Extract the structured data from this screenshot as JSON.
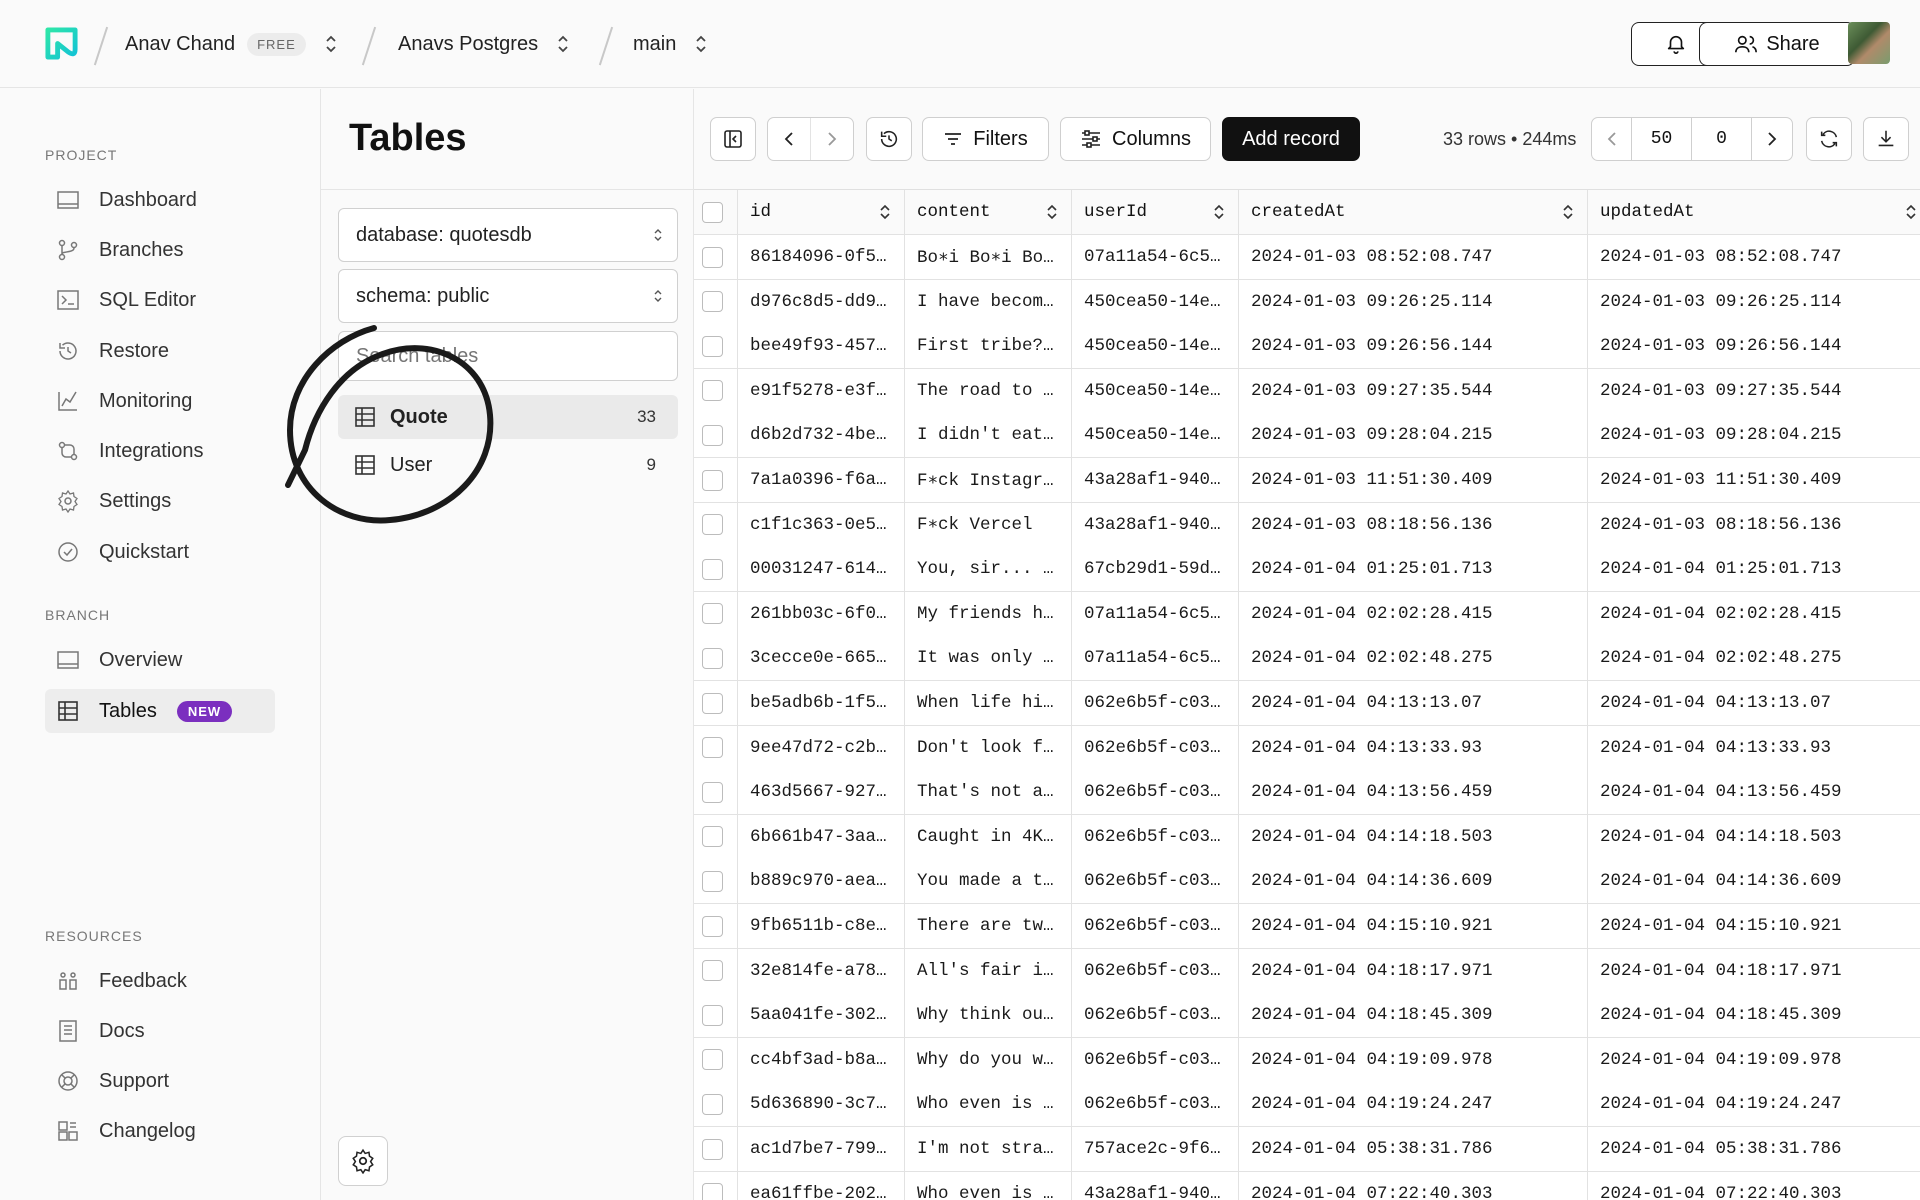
{
  "topbar": {
    "org_name": "Anav Chand",
    "plan_badge": "FREE",
    "project_name": "Anavs Postgres",
    "branch_name": "main",
    "share_label": "Share"
  },
  "sidebar": {
    "project_label": "PROJECT",
    "project_items": [
      {
        "label": "Dashboard",
        "icon": "dashboard-icon"
      },
      {
        "label": "Branches",
        "icon": "branches-icon"
      },
      {
        "label": "SQL Editor",
        "icon": "sql-editor-icon"
      },
      {
        "label": "Restore",
        "icon": "restore-icon"
      },
      {
        "label": "Monitoring",
        "icon": "monitoring-icon"
      },
      {
        "label": "Integrations",
        "icon": "integrations-icon"
      },
      {
        "label": "Settings",
        "icon": "settings-icon"
      },
      {
        "label": "Quickstart",
        "icon": "quickstart-icon"
      }
    ],
    "branch_label": "BRANCH",
    "branch_items": [
      {
        "label": "Overview",
        "icon": "overview-icon"
      },
      {
        "label": "Tables",
        "icon": "tables-icon",
        "badge": "NEW",
        "active": true
      }
    ],
    "resources_label": "RESOURCES",
    "resource_items": [
      {
        "label": "Feedback",
        "icon": "feedback-icon"
      },
      {
        "label": "Docs",
        "icon": "docs-icon"
      },
      {
        "label": "Support",
        "icon": "support-icon"
      },
      {
        "label": "Changelog",
        "icon": "changelog-icon"
      }
    ],
    "accent_color": "#7b2fbf"
  },
  "tables_panel": {
    "title": "Tables",
    "database_select": "database: quotesdb",
    "schema_select": "schema: public",
    "search_placeholder": "Search tables",
    "tables": [
      {
        "name": "Quote",
        "count": "33",
        "active": true
      },
      {
        "name": "User",
        "count": "9",
        "active": false
      }
    ]
  },
  "toolbar": {
    "filters_label": "Filters",
    "columns_label": "Columns",
    "add_record_label": "Add record",
    "rows_info": "33 rows • 244ms",
    "page_limit": "50",
    "page_offset": "0"
  },
  "grid": {
    "columns": [
      "id",
      "content",
      "userId",
      "createdAt",
      "updatedAt"
    ],
    "rows": [
      [
        "86184096-0f5…",
        "Bo∗i Bo∗i Bo…",
        "07a11a54-6c5…",
        "2024-01-03 08:52:08.747",
        "2024-01-03 08:52:08.747"
      ],
      [
        "d976c8d5-dd9…",
        "I have becom…",
        "450cea50-14e…",
        "2024-01-03 09:26:25.114",
        "2024-01-03 09:26:25.114"
      ],
      [
        "bee49f93-457…",
        "First tribe?…",
        "450cea50-14e…",
        "2024-01-03 09:26:56.144",
        "2024-01-03 09:26:56.144"
      ],
      [
        "e91f5278-e3f…",
        "The road to …",
        "450cea50-14e…",
        "2024-01-03 09:27:35.544",
        "2024-01-03 09:27:35.544"
      ],
      [
        "d6b2d732-4be…",
        "I didn't eat…",
        "450cea50-14e…",
        "2024-01-03 09:28:04.215",
        "2024-01-03 09:28:04.215"
      ],
      [
        "7a1a0396-f6a…",
        "F∗ck Instagr…",
        "43a28af1-940…",
        "2024-01-03 11:51:30.409",
        "2024-01-03 11:51:30.409"
      ],
      [
        "c1f1c363-0e5…",
        "F∗ck Vercel",
        "43a28af1-940…",
        "2024-01-03 08:18:56.136",
        "2024-01-03 08:18:56.136"
      ],
      [
        "00031247-614…",
        "You, sir... …",
        "67cb29d1-59d…",
        "2024-01-04 01:25:01.713",
        "2024-01-04 01:25:01.713"
      ],
      [
        "261bb03c-6f0…",
        "My friends h…",
        "07a11a54-6c5…",
        "2024-01-04 02:02:28.415",
        "2024-01-04 02:02:28.415"
      ],
      [
        "3cecce0e-665…",
        "It was only …",
        "07a11a54-6c5…",
        "2024-01-04 02:02:48.275",
        "2024-01-04 02:02:48.275"
      ],
      [
        "be5adb6b-1f5…",
        "When life hi…",
        "062e6b5f-c03…",
        "2024-01-04 04:13:13.07",
        "2024-01-04 04:13:13.07"
      ],
      [
        "9ee47d72-c2b…",
        "Don't look f…",
        "062e6b5f-c03…",
        "2024-01-04 04:13:33.93",
        "2024-01-04 04:13:33.93"
      ],
      [
        "463d5667-927…",
        "That's not a…",
        "062e6b5f-c03…",
        "2024-01-04 04:13:56.459",
        "2024-01-04 04:13:56.459"
      ],
      [
        "6b661b47-3aa…",
        "Caught in 4K…",
        "062e6b5f-c03…",
        "2024-01-04 04:14:18.503",
        "2024-01-04 04:14:18.503"
      ],
      [
        "b889c970-aea…",
        "You made a t…",
        "062e6b5f-c03…",
        "2024-01-04 04:14:36.609",
        "2024-01-04 04:14:36.609"
      ],
      [
        "9fb6511b-c8e…",
        "There are tw…",
        "062e6b5f-c03…",
        "2024-01-04 04:15:10.921",
        "2024-01-04 04:15:10.921"
      ],
      [
        "32e814fe-a78…",
        "All's fair i…",
        "062e6b5f-c03…",
        "2024-01-04 04:18:17.971",
        "2024-01-04 04:18:17.971"
      ],
      [
        "5aa041fe-302…",
        "Why think ou…",
        "062e6b5f-c03…",
        "2024-01-04 04:18:45.309",
        "2024-01-04 04:18:45.309"
      ],
      [
        "cc4bf3ad-b8a…",
        "Why do you w…",
        "062e6b5f-c03…",
        "2024-01-04 04:19:09.978",
        "2024-01-04 04:19:09.978"
      ],
      [
        "5d636890-3c7…",
        "Who even is …",
        "062e6b5f-c03…",
        "2024-01-04 04:19:24.247",
        "2024-01-04 04:19:24.247"
      ],
      [
        "ac1d7be7-799…",
        "I'm not stra…",
        "757ace2c-9f6…",
        "2024-01-04 05:38:31.786",
        "2024-01-04 05:38:31.786"
      ],
      [
        "ea61ffbe-202…",
        "Who even is …",
        "43a28af1-940…",
        "2024-01-04 07:22:40.303",
        "2024-01-04 07:22:40.303"
      ]
    ]
  }
}
